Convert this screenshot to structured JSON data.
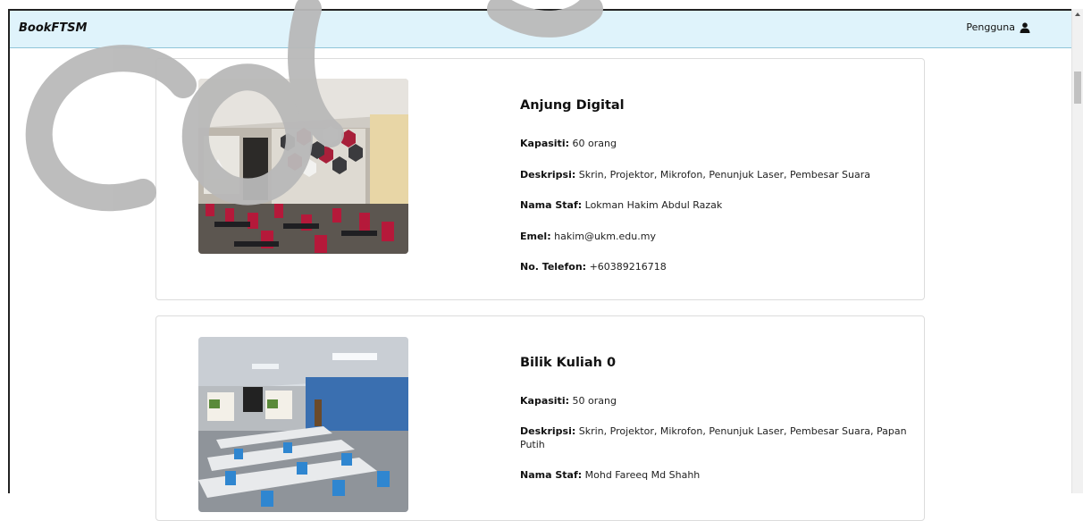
{
  "navbar": {
    "brand": "BookFTSM",
    "user_label": "Pengguna",
    "user_icon": "user-icon"
  },
  "rooms": [
    {
      "name": "Anjung Digital",
      "capacity_label": "Kapasiti:",
      "capacity_value": "60 orang",
      "description_label": "Deskripsi:",
      "description_value": "Skrin, Projektor, Mikrofon, Penunjuk Laser, Pembesar Suara",
      "staff_label": "Nama Staf:",
      "staff_value": "Lokman Hakim Abdul Razak",
      "email_label": "Emel:",
      "email_value": "hakim@ukm.edu.my",
      "phone_label": "No. Telefon:",
      "phone_value": "+60389216718"
    },
    {
      "name": "Bilik Kuliah 0",
      "capacity_label": "Kapasiti:",
      "capacity_value": "50 orang",
      "description_label": "Deskripsi:",
      "description_value": "Skrin, Projektor, Mikrofon, Penunjuk Laser, Pembesar Suara, Papan Putih",
      "staff_label": "Nama Staf:",
      "staff_value": "Mohd Fareeq Md Shahh"
    }
  ],
  "colors": {
    "navbar_bg": "#dff3fb",
    "card_border": "#dcdcdc",
    "seat_red": "#b5193a"
  }
}
